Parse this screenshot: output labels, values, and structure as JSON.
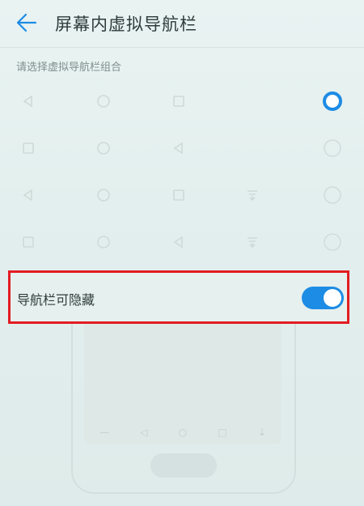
{
  "header": {
    "title": "屏幕内虚拟导航栏"
  },
  "section": {
    "label": "请选择虚拟导航栏组合"
  },
  "options": [
    {
      "buttons": [
        "back",
        "home",
        "recent"
      ],
      "selected": true
    },
    {
      "buttons": [
        "recent",
        "home",
        "back"
      ],
      "selected": false
    },
    {
      "buttons": [
        "back",
        "home",
        "recent",
        "notification"
      ],
      "selected": false
    },
    {
      "buttons": [
        "recent",
        "home",
        "back",
        "notification"
      ],
      "selected": false
    }
  ],
  "toggle": {
    "label": "导航栏可隐藏",
    "on": true
  },
  "colors": {
    "accent": "#1d8ce5",
    "highlight_border": "#e21c22"
  }
}
